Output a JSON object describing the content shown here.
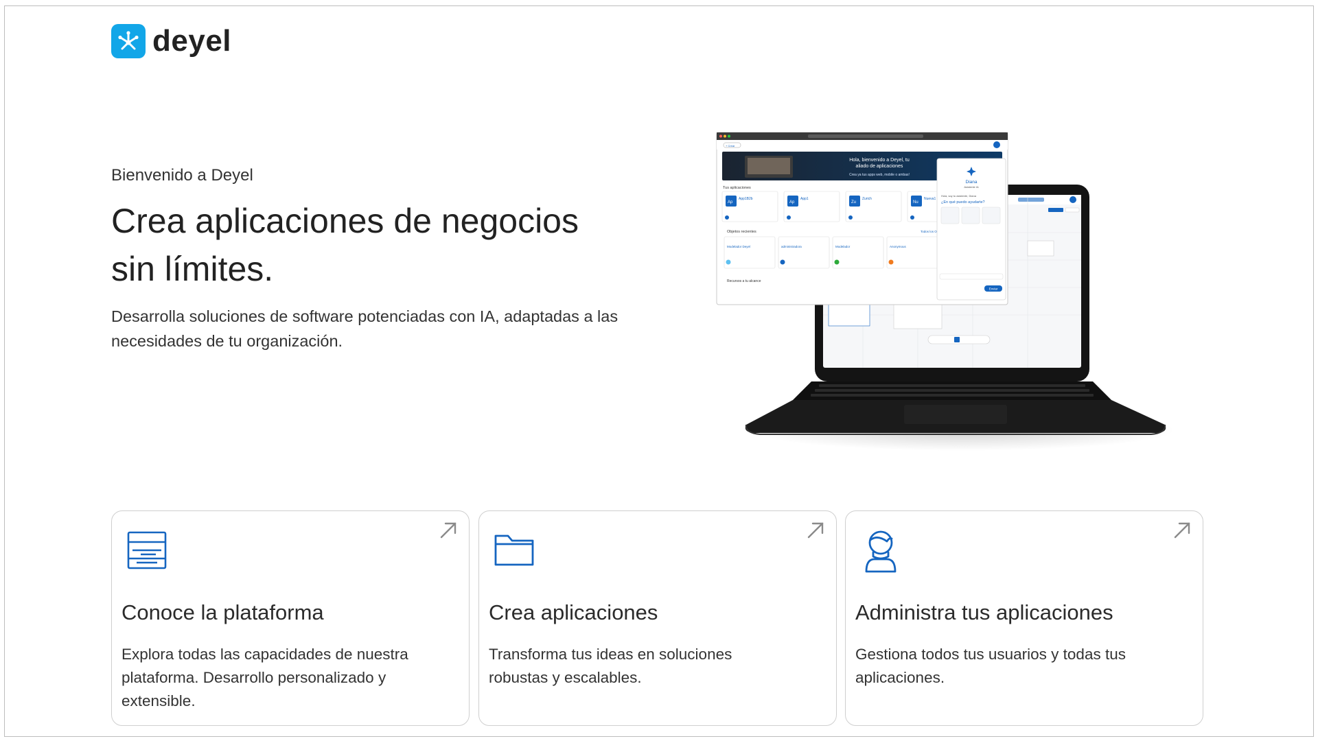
{
  "brand": {
    "name": "deyel",
    "accent": "#12a6e8",
    "icon_blue": "#1565c0"
  },
  "hero": {
    "welcome": "Bienvenido a Deyel",
    "title_line1": "Crea aplicaciones de negocios",
    "title_line2": "sin límites.",
    "description": "Desarrolla soluciones de software potenciadas con IA, adaptadas a las necesidades de tu organización."
  },
  "cards": [
    {
      "icon": "server-list-icon",
      "title": "Conoce la plataforma",
      "description": "Explora todas las capacidades de nuestra plataforma. Desarrollo personalizado y extensible."
    },
    {
      "icon": "folder-icon",
      "title": "Crea aplicaciones",
      "description": "Transforma tus ideas en soluciones robustas y escalables."
    },
    {
      "icon": "user-admin-icon",
      "title": "Administra tus aplicaciones",
      "description": "Gestiona todos tus usuarios y todas tus aplicaciones."
    }
  ],
  "screen": {
    "banner_line1": "Hola, bienvenido a Deyel, tu",
    "banner_line2": "aliado de aplicaciones",
    "banner_sub": "Crea ya tus apps web, mobile o ambas!",
    "apps_heading": "Tus aplicaciones",
    "apps": [
      {
        "abbr": "Ap",
        "name": "App1B2b"
      },
      {
        "abbr": "Ap",
        "name": "App1"
      },
      {
        "abbr": "Zu",
        "name": "Zurich"
      },
      {
        "abbr": "Nu",
        "name": "Nueva1"
      }
    ],
    "recent_heading": "Objetos recientes",
    "recent_link": "Todos los Objetos",
    "recent": [
      "Modelador Deyel",
      "administradora",
      "Modelador",
      "Anonymous"
    ],
    "resources_heading": "Recursos a tu alcance",
    "assistant_name": "Diana",
    "assistant_role": "Asistente IA",
    "assistant_greeting": "Hola, soy tu asistente, Diana",
    "assistant_question": "¿En qué puedo ayudarte?",
    "assistant_button": "Enviar"
  }
}
